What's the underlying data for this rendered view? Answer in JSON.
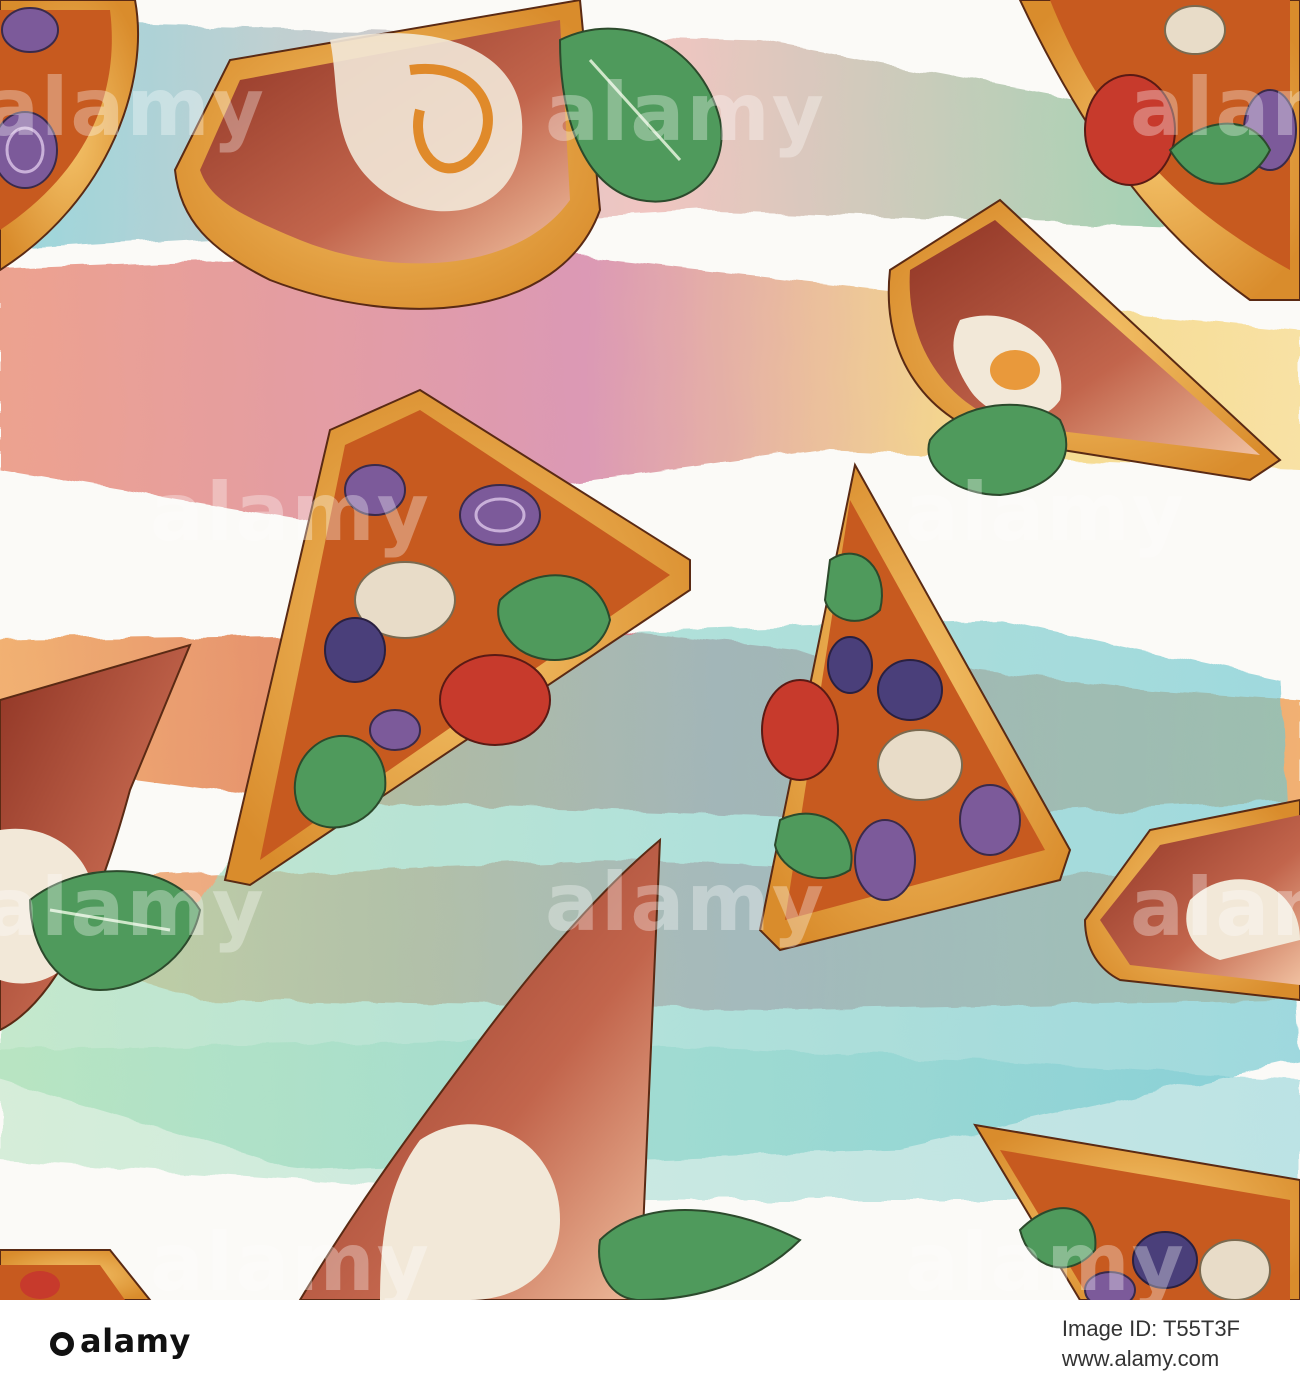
{
  "image": {
    "subject": "seamless watercolor pattern of pizza slices with prosciutto, basil, olives, red onion, mushrooms and tomato on colorful brushstrokes",
    "palette": {
      "paper": "#fbfaf7",
      "salmon": "#e8866e",
      "magenta": "#d27aa0",
      "yellow": "#f3cf6a",
      "green": "#8fd3a3",
      "teal": "#5fc1cc",
      "orange": "#ee9a4a",
      "crust": "#e2a64a",
      "sauce": "#c75a1f",
      "prosciutto": "#a8432c",
      "basil": "#4f9a5c",
      "olive": "#4a3f7a",
      "onion": "#7c5a9a",
      "tomato": "#c73a2c",
      "mushroom": "#e8dcc8"
    }
  },
  "watermark": {
    "text": "alamy"
  },
  "footer": {
    "logo": "alamy",
    "image_id_line": "Image ID: T55T3F",
    "site_line": "www.alamy.com"
  }
}
